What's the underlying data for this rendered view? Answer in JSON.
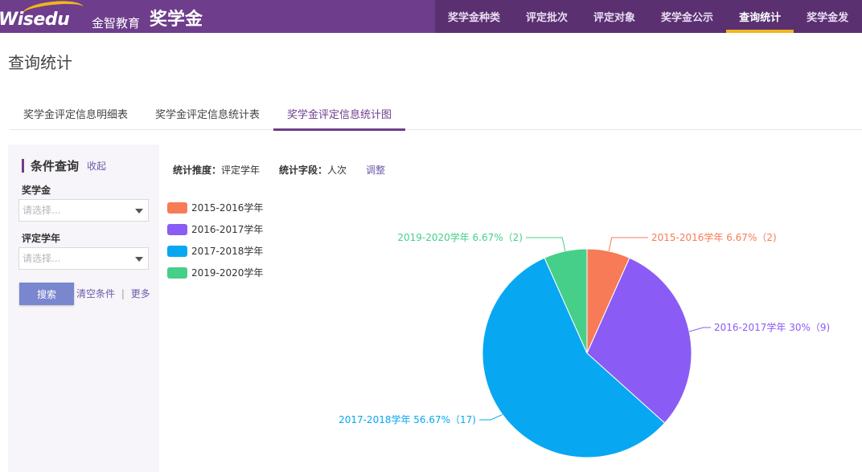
{
  "brand": {
    "logo_text": "Wisedu",
    "logo_cn": "金智教育",
    "app_title": "奖学金"
  },
  "topnav": {
    "items": [
      {
        "label": "奖学金种类",
        "active": false
      },
      {
        "label": "评定批次",
        "active": false
      },
      {
        "label": "评定对象",
        "active": false
      },
      {
        "label": "奖学金公示",
        "active": false
      },
      {
        "label": "查询统计",
        "active": true
      },
      {
        "label": "奖学金发",
        "active": false
      }
    ]
  },
  "page": {
    "title": "查询统计"
  },
  "tabs": [
    {
      "label": "奖学金评定信息明细表",
      "active": false
    },
    {
      "label": "奖学金评定信息统计表",
      "active": false
    },
    {
      "label": "奖学金评定信息统计图",
      "active": true
    }
  ],
  "filter": {
    "title": "条件查询",
    "collapse": "收起",
    "fields": [
      {
        "label": "奖学金",
        "placeholder": "请选择..."
      },
      {
        "label": "评定学年",
        "placeholder": "请选择..."
      }
    ],
    "search_button": "搜索",
    "clear_link": "清空条件",
    "separator": "|",
    "more_link": "更多"
  },
  "stats": {
    "dimension_label": "统计推度：",
    "dimension_value": "评定学年",
    "field_label": "统计字段：",
    "field_value": "人次",
    "adjust": "调整"
  },
  "colors": {
    "brand": "#6e3d8c",
    "accent": "#f1b51c"
  },
  "chart_data": {
    "type": "pie",
    "series": [
      {
        "name": "2015-2016学年",
        "value": 2,
        "percent": "6.67%",
        "label": "2015-2016学年 6.67%（2)",
        "color": "#f77b56"
      },
      {
        "name": "2016-2017学年",
        "value": 9,
        "percent": "30%",
        "label": "2016-2017学年 30%（9)",
        "color": "#8a5cf5"
      },
      {
        "name": "2017-2018学年",
        "value": 17,
        "percent": "56.67%",
        "label": "2017-2018学年 56.67%（17)",
        "color": "#07a7f2"
      },
      {
        "name": "2019-2020学年",
        "value": 2,
        "percent": "6.67%",
        "label": "2019-2020学年 6.67%（2)",
        "color": "#45cf88"
      }
    ],
    "legend_position": "top-left"
  }
}
